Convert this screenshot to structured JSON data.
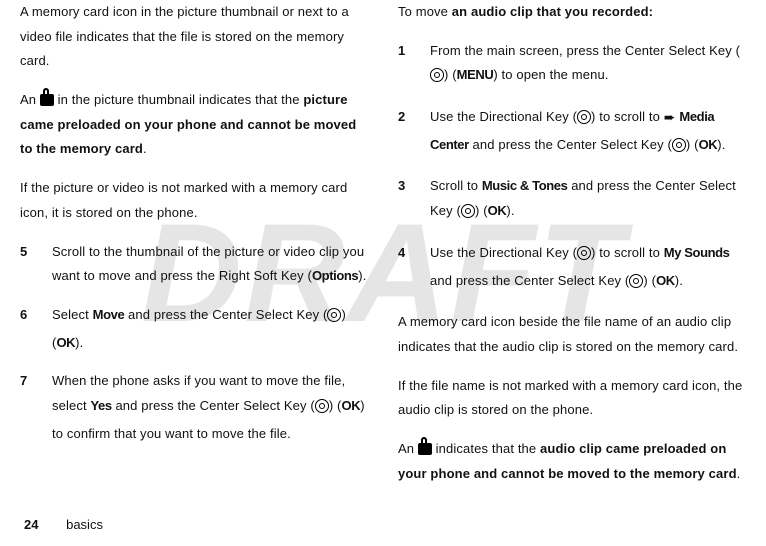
{
  "watermark": "DRAFT",
  "left": {
    "p1": "A memory card icon in the picture thumbnail or next to a video file indicates that the file is stored on the memory card.",
    "p2_a": "An ",
    "p2_b": " in the picture thumbnail indicates that the ",
    "p2_bold": "picture came preloaded on your phone and cannot be moved to the memory card",
    "p2_c": ".",
    "p3": "If the picture or video is not marked with a memory card icon, it is stored on the phone.",
    "step5_num": "5",
    "step5_a": "Scroll to the thumbnail of the picture or video clip you want to move and press the Right Soft Key (",
    "step5_key": "Options",
    "step5_b": ").",
    "step6_num": "6",
    "step6_a": "Select ",
    "step6_move": "Move",
    "step6_b": " and press the Center Select Key (",
    "step6_c": ") (",
    "step6_ok": "OK",
    "step6_d": ").",
    "step7_num": "7",
    "step7_a": "When the phone asks if you want to move the file, select ",
    "step7_yes": "Yes",
    "step7_b": " and press the Center Select Key (",
    "step7_c": ") (",
    "step7_ok": "OK",
    "step7_d": ") to confirm that you want to move the file."
  },
  "right": {
    "intro_a": "To move ",
    "intro_bold": "an audio clip that you recorded:",
    "step1_num": "1",
    "step1_a": "From the main screen, press the Center Select Key (",
    "step1_b": ") (",
    "step1_menu": "MENU",
    "step1_c": ") to open the menu.",
    "step2_num": "2",
    "step2_a": "Use the Directional Key (",
    "step2_b": ") to scroll to ",
    "step2_media": "Media Center",
    "step2_c": " and press the Center Select Key (",
    "step2_d": ") (",
    "step2_ok": "OK",
    "step2_e": ").",
    "step3_num": "3",
    "step3_a": "Scroll to ",
    "step3_music": "Music & Tones",
    "step3_b": " and press the Center Select Key (",
    "step3_c": ") (",
    "step3_ok": "OK",
    "step3_d": ").",
    "step4_num": "4",
    "step4_a": "Use the Directional Key (",
    "step4_b": ") to scroll to ",
    "step4_mysounds": "My Sounds",
    "step4_c": " and press the Center Select Key (",
    "step4_d": ") (",
    "step4_ok": "OK",
    "step4_e": ").",
    "p5": "A memory card icon beside the file name of an audio clip indicates that the audio clip is stored on the memory card.",
    "p6": "If the file name is not marked with a memory card icon, the audio clip is stored on the phone.",
    "p7_a": "An ",
    "p7_b": " indicates that the ",
    "p7_bold": "audio clip came preloaded on your phone and cannot be moved to the memory card",
    "p7_c": "."
  },
  "footer": {
    "page": "24",
    "section": "basics"
  }
}
